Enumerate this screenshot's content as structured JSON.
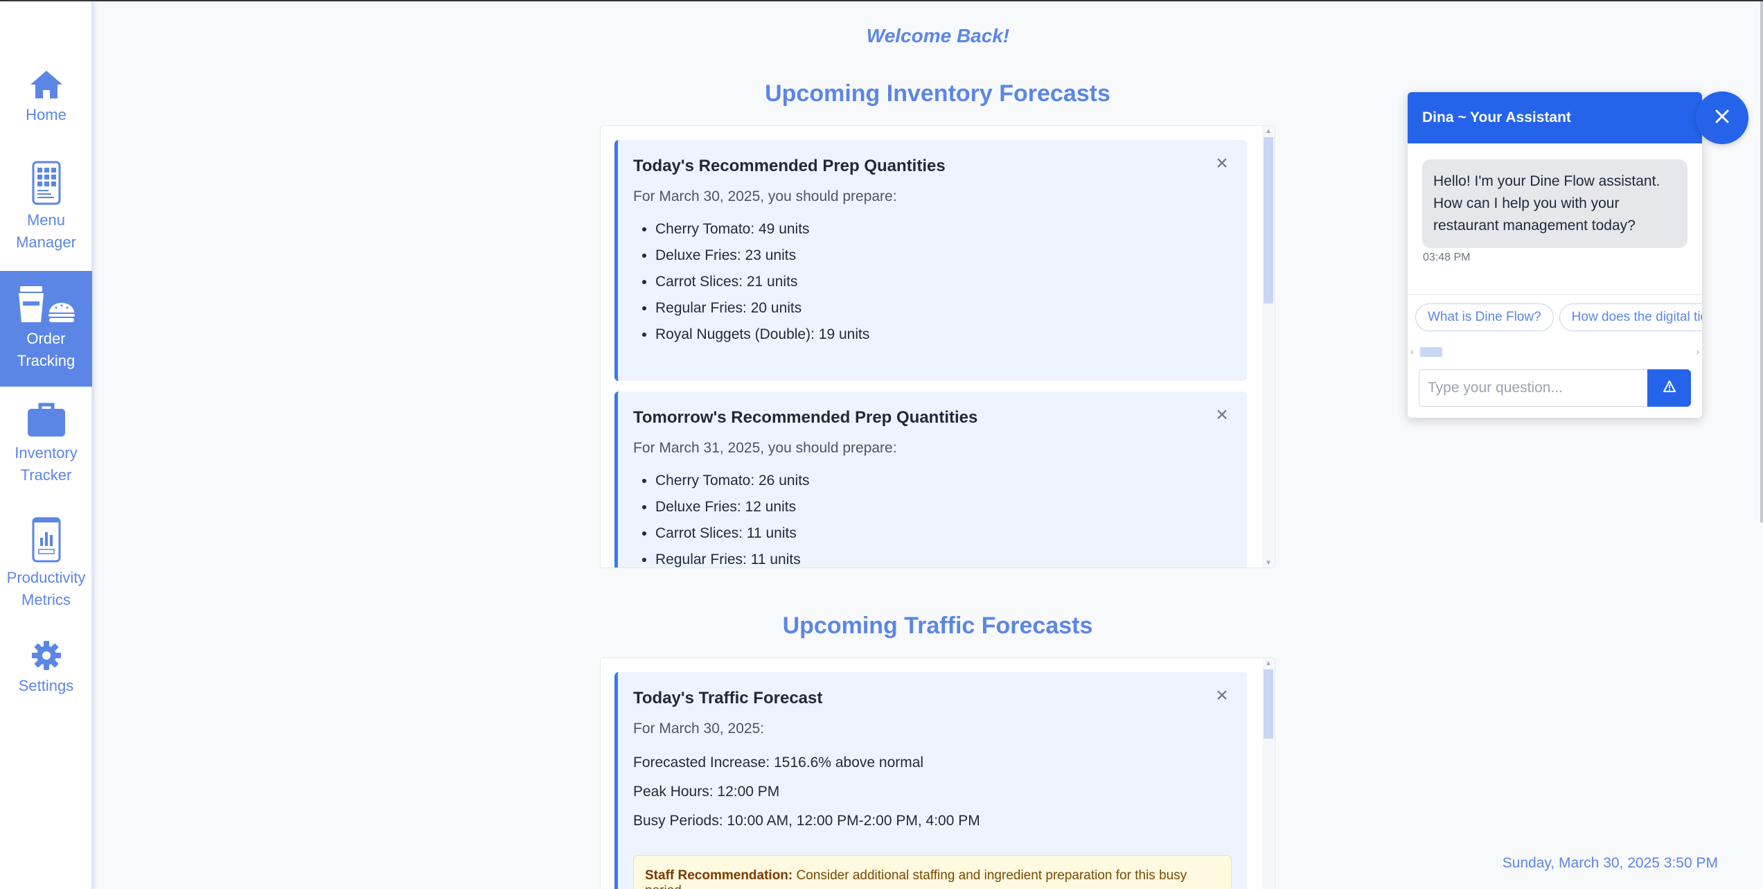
{
  "sidebar": {
    "items": [
      {
        "label": "Home",
        "icon": "home-icon",
        "active": false
      },
      {
        "label": "Menu\nManager",
        "icon": "menu-tablet-icon",
        "active": false
      },
      {
        "label": "Order\nTracking",
        "icon": "drink-burger-icon",
        "active": true
      },
      {
        "label": "Inventory\nTracker",
        "icon": "briefcase-icon",
        "active": false
      },
      {
        "label": "Productivity\nMetrics",
        "icon": "phone-chart-icon",
        "active": false
      },
      {
        "label": "Settings",
        "icon": "gear-icon",
        "active": false
      }
    ]
  },
  "main": {
    "welcome": "Welcome Back!",
    "inventory": {
      "title": "Upcoming Inventory Forecasts",
      "cards": [
        {
          "title": "Today's Recommended Prep Quantities",
          "subtitle": "For March 30, 2025, you should prepare:",
          "items": [
            "Cherry Tomato: 49 units",
            "Deluxe Fries: 23 units",
            "Carrot Slices: 21 units",
            "Regular Fries: 20 units",
            "Royal Nuggets (Double): 19 units"
          ]
        },
        {
          "title": "Tomorrow's Recommended Prep Quantities",
          "subtitle": "For March 31, 2025, you should prepare:",
          "items": [
            "Cherry Tomato: 26 units",
            "Deluxe Fries: 12 units",
            "Carrot Slices: 11 units",
            "Regular Fries: 11 units"
          ]
        }
      ]
    },
    "traffic": {
      "title": "Upcoming Traffic Forecasts",
      "card": {
        "title": "Today's Traffic Forecast",
        "subtitle": "For March 30, 2025:",
        "increase": "Forecasted Increase: 1516.6% above normal",
        "peak": "Peak Hours: 12:00 PM",
        "busy": "Busy Periods: 10:00 AM, 12:00 PM-2:00 PM, 4:00 PM",
        "staff_label": "Staff Recommendation:",
        "staff_text": "Consider additional staffing and ingredient preparation for this busy period."
      }
    },
    "close_symbol": "×"
  },
  "chat": {
    "title": "Dina ~ Your Assistant",
    "message": "Hello! I'm your Dine Flow assistant. How can I help you with your restaurant management today?",
    "time": "03:48 PM",
    "chips": [
      "What is Dine Flow?",
      "How does the digital ticket system work?"
    ],
    "input_placeholder": "Type your question...",
    "send_icon": "send-icon",
    "accent": "#2563eb"
  },
  "datetime": "Sunday, March 30, 2025 3:50 PM",
  "colors": {
    "primary": "#5b86e5",
    "card_bg": "#edf4ff",
    "card_border": "#3b7ae8"
  }
}
